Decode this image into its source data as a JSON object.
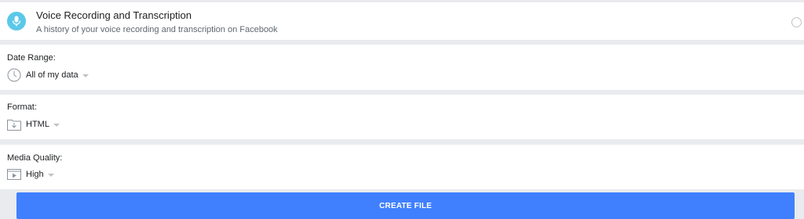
{
  "category": {
    "title": "Voice Recording and Transcription",
    "description": "A history of your voice recording and transcription on Facebook",
    "icon": "microphone-icon",
    "icon_color": "#5ac8e8"
  },
  "date_range": {
    "label": "Date Range:",
    "value": "All of my data",
    "icon": "clock-icon"
  },
  "format": {
    "label": "Format:",
    "value": "HTML",
    "icon": "download-folder-icon"
  },
  "media_quality": {
    "label": "Media Quality:",
    "value": "High",
    "icon": "video-play-icon"
  },
  "create_button": {
    "label": "CREATE FILE",
    "color": "#4080ff"
  }
}
